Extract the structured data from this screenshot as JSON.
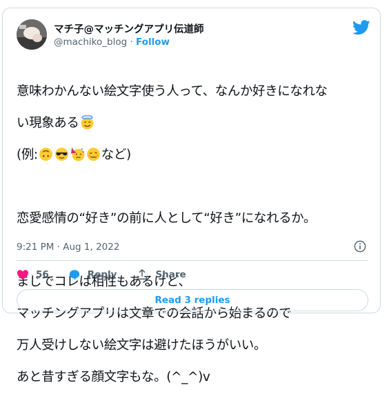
{
  "tweet": {
    "author_name": "マチ子@マッチングアプリ伝道師",
    "handle": "@machiko_blog",
    "separator": "·",
    "follow_label": "Follow",
    "line1": "意味わかんない絵文字使う人って、なんか好きになれな",
    "line2": "い現象ある",
    "line3_prefix": "(例:",
    "line3_suffix": "など)",
    "line4": "恋愛感情の“好き”の前に人として“好き”になれるか。",
    "line5": "まじでコレは相性もあるけど、",
    "line6": "マッチングアプリは文章での会話から始まるので",
    "line7": "万人受けしない絵文字は避けたほうがいい。",
    "line8": "あと昔すぎる顔文字もな。(^_^)v",
    "timestamp": "9:21 PM · Aug 1, 2022",
    "like_count": "56",
    "reply_label": "Reply",
    "share_label": "Share",
    "read_replies_label": "Read 3 replies"
  },
  "colors": {
    "accent": "#1d9bf0",
    "like": "#f91880",
    "text": "#0f1419",
    "muted": "#536471"
  },
  "icons": [
    "twitter-bird-icon",
    "info-icon",
    "heart-icon",
    "reply-icon",
    "share-icon",
    "halo-face-emoji",
    "upside-down-face-emoji",
    "sunglasses-face-emoji",
    "party-face-emoji",
    "woozy-face-emoji"
  ]
}
